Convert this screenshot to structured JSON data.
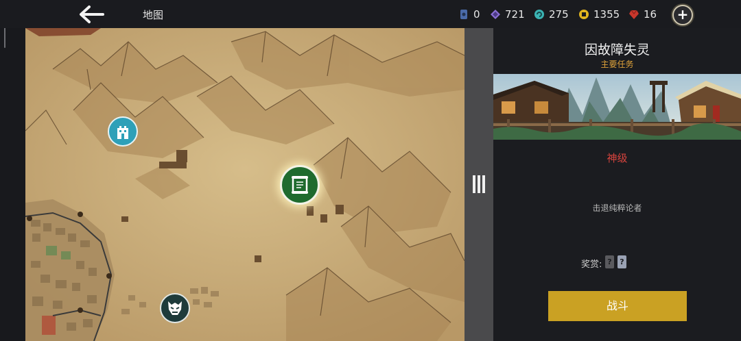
{
  "header": {
    "back_icon": "arrow-left-icon",
    "title": "地图",
    "add_icon": "plus-icon"
  },
  "resources": [
    {
      "name": "ticket",
      "icon": "ticket-icon",
      "value": "0",
      "color": "#4a6aa8"
    },
    {
      "name": "crystal",
      "icon": "diamond-icon",
      "value": "721",
      "color": "#8b6fd6"
    },
    {
      "name": "spiral",
      "icon": "spiral-icon",
      "value": "275",
      "color": "#3bb3b3"
    },
    {
      "name": "coin",
      "icon": "coin-icon",
      "value": "1355",
      "color": "#e1b51f"
    },
    {
      "name": "gem",
      "icon": "gem-icon",
      "value": "16",
      "color": "#c8372c"
    }
  ],
  "map": {
    "markers": [
      {
        "icon": "tower-icon",
        "color": "#2ea0b8"
      },
      {
        "icon": "scroll-icon",
        "color": "#1f6b2e",
        "selected": true
      },
      {
        "icon": "demon-mask-icon",
        "color": "#1e3b3b"
      }
    ],
    "drawer_icon": "drag-handle-icon"
  },
  "mission": {
    "title": "因故障失灵",
    "type": "主要任务",
    "difficulty": "神级",
    "objective": "击退纯粹论者",
    "reward_label": "奖赏:",
    "rewards": [
      "?",
      "?"
    ],
    "fight_label": "战斗"
  },
  "colors": {
    "accent_gold": "#caa123",
    "mission_type": "#e0a33a",
    "difficulty": "#d8443e",
    "background": "#1b1c20",
    "map_paper": "#c8ad7a"
  }
}
